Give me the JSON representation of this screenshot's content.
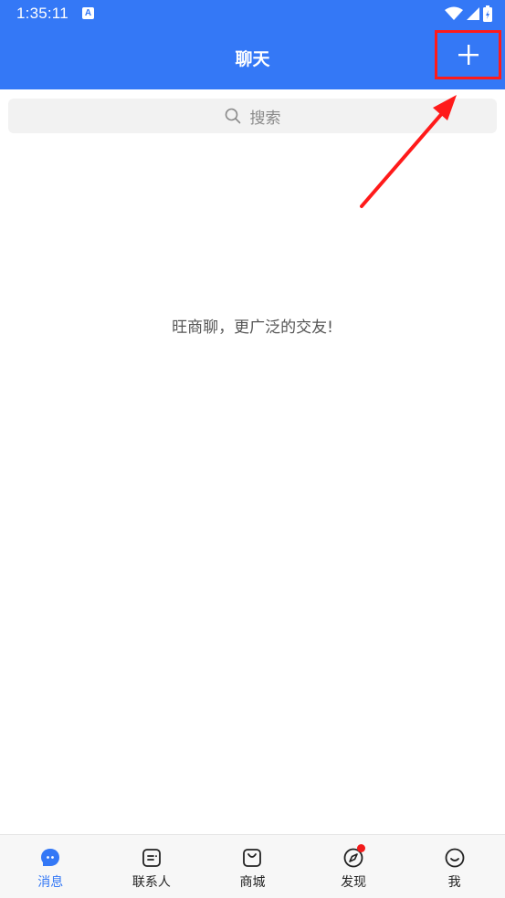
{
  "status_bar": {
    "time": "1:35:11",
    "notification_icon": "A"
  },
  "header": {
    "title": "聊天",
    "action_icon": "plus-icon"
  },
  "search": {
    "placeholder": "搜索"
  },
  "main": {
    "empty_message": "旺商聊，更广泛的交友!"
  },
  "bottom_nav": {
    "items": [
      {
        "label": "消息",
        "icon": "chat-bubble-icon",
        "active": true
      },
      {
        "label": "联系人",
        "icon": "contacts-icon",
        "active": false
      },
      {
        "label": "商城",
        "icon": "shopping-bag-icon",
        "active": false
      },
      {
        "label": "发现",
        "icon": "compass-icon",
        "active": false,
        "badge": true
      },
      {
        "label": "我",
        "icon": "smile-icon",
        "active": false
      }
    ]
  },
  "colors": {
    "brand": "#3478f6",
    "highlight": "#ff1a1a",
    "badge": "#f21b1b"
  }
}
